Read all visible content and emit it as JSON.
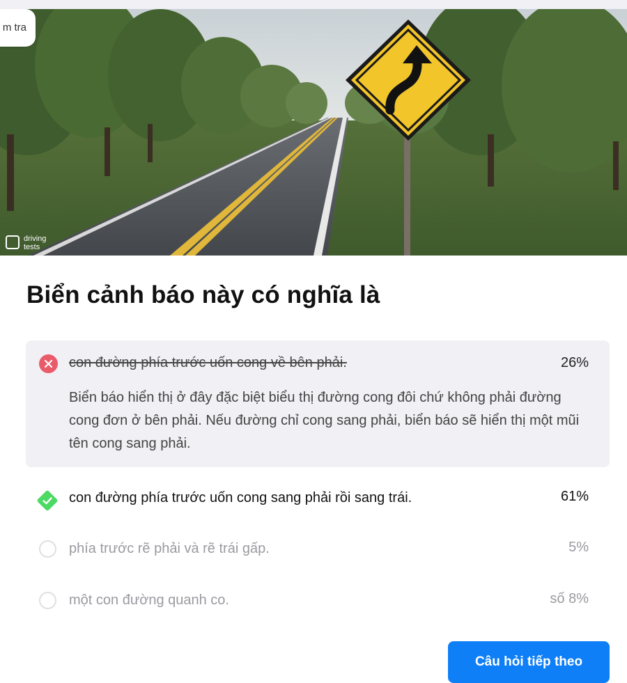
{
  "tab": {
    "label": "m tra"
  },
  "hero": {
    "watermark_line1": "driving",
    "watermark_line2": "tests",
    "sign_color": "#f2c52a"
  },
  "question": {
    "title": "Biển cảnh báo này có nghĩa là"
  },
  "answers": [
    {
      "text": "con đường phía trước uốn cong về bên phải.",
      "percent": "26%",
      "state": "wrong",
      "explanation": "Biển báo hiển thị ở đây đặc biệt biểu thị đường cong đôi chứ không phải đường cong đơn ở bên phải. Nếu đường chỉ cong sang phải, biển báo sẽ hiển thị một mũi tên cong sang phải."
    },
    {
      "text": "con đường phía trước uốn cong sang phải rồi sang trái.",
      "percent": "61%",
      "state": "correct"
    },
    {
      "text": "phía trước rẽ phải và rẽ trái gấp.",
      "percent": "5%",
      "state": "unselected"
    },
    {
      "text": "một con đường quanh co.",
      "percent": "số 8%",
      "state": "unselected"
    }
  ],
  "next_button": {
    "label": "Câu hỏi tiếp theo"
  },
  "colors": {
    "accent": "#0f7ff7",
    "wrong": "#ea5b6a",
    "correct": "#4cd964",
    "panel": "#f0f0f5"
  }
}
